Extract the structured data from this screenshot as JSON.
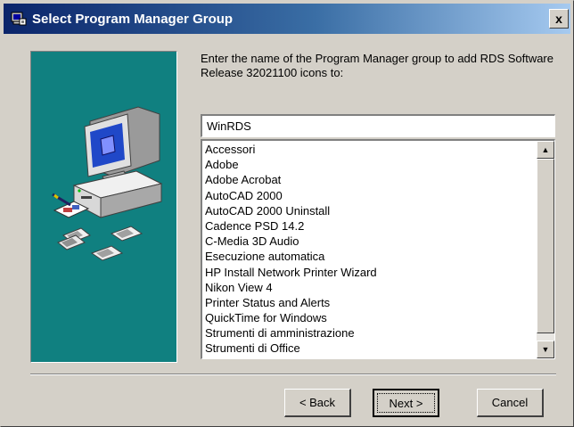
{
  "window": {
    "title": "Select Program Manager Group",
    "close_symbol": "x"
  },
  "instruction": "Enter the name of the Program Manager group to add RDS Software Release 32021100 icons to:",
  "group_input": {
    "value": "WinRDS"
  },
  "group_list": {
    "items": [
      "Accessori",
      "Adobe",
      "Adobe Acrobat",
      "AutoCAD 2000",
      "AutoCAD 2000 Uninstall",
      "Cadence PSD 14.2",
      "C-Media 3D Audio",
      "Esecuzione automatica",
      "HP Install Network Printer Wizard",
      "Nikon View 4",
      "Printer Status and Alerts",
      "QuickTime for Windows",
      "Strumenti di amministrazione",
      "Strumenti di Office"
    ]
  },
  "buttons": {
    "back": "< Back",
    "next": "Next >",
    "cancel": "Cancel"
  },
  "icons": {
    "title_icon": "setup-app-icon",
    "art": "computer-install-icon",
    "scroll_up": "arrow-up-icon",
    "scroll_down": "arrow-down-icon"
  },
  "colors": {
    "title_gradient_start": "#0a246a",
    "title_gradient_end": "#a6caf0",
    "art_background": "#108080",
    "dialog_face": "#d4d0c8"
  }
}
